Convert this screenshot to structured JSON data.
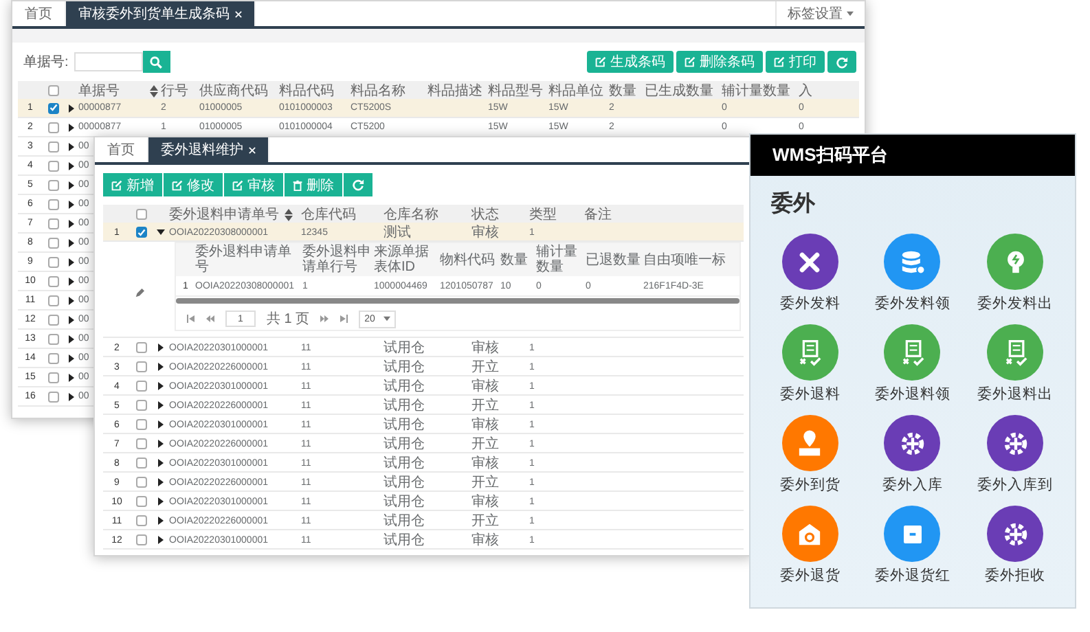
{
  "back_window": {
    "tabs": [
      {
        "label": "首页",
        "selected": false
      },
      {
        "label": "审核委外到货单生成条码",
        "selected": true
      }
    ],
    "tab_settings": "标签设置",
    "search": {
      "label": "单据号:"
    },
    "buttons": [
      {
        "label": "生成条码",
        "kind": "edit"
      },
      {
        "label": "删除条码",
        "kind": "edit"
      },
      {
        "label": "打印",
        "kind": "edit"
      },
      {
        "kind": "refresh"
      }
    ],
    "table": {
      "all_checked": false,
      "columns": [
        "单据号",
        "行号",
        "供应商代码",
        "料品代码",
        "料品名称",
        "料品描述",
        "料品型号",
        "料品单位",
        "数量",
        "已生成数量",
        "辅计量数量",
        "入"
      ],
      "rows": [
        {
          "index": "1",
          "checked": true,
          "expanded": false,
          "cells": [
            "00000877",
            "2",
            "01000005",
            "0101000003",
            "CT5200S",
            null,
            "15W",
            "15W",
            "2",
            null,
            "0",
            "0"
          ]
        },
        {
          "index": "2",
          "checked": false,
          "expanded": false,
          "cells": [
            "00000877",
            "1",
            "01000005",
            "0101000004",
            "CT5200",
            null,
            "15W",
            "15W",
            "2",
            null,
            "0",
            "0"
          ]
        },
        {
          "index": "3",
          "checked": false,
          "expanded": false,
          "cells": [
            "00"
          ]
        },
        {
          "index": "4",
          "checked": false,
          "expanded": false,
          "cells": [
            "00"
          ]
        },
        {
          "index": "5",
          "checked": false,
          "expanded": false,
          "cells": [
            "00"
          ]
        },
        {
          "index": "6",
          "checked": false,
          "expanded": false,
          "cells": [
            "00"
          ]
        },
        {
          "index": "7",
          "checked": false,
          "expanded": false,
          "cells": [
            "00"
          ]
        },
        {
          "index": "8",
          "checked": false,
          "expanded": false,
          "cells": [
            "00"
          ]
        },
        {
          "index": "9",
          "checked": false,
          "expanded": false,
          "cells": [
            "00"
          ]
        },
        {
          "index": "10",
          "checked": false,
          "expanded": false,
          "cells": [
            "00"
          ]
        },
        {
          "index": "11",
          "checked": false,
          "expanded": false,
          "cells": [
            "00"
          ]
        },
        {
          "index": "12",
          "checked": false,
          "expanded": false,
          "cells": [
            "00"
          ]
        },
        {
          "index": "13",
          "checked": false,
          "expanded": false,
          "cells": [
            "00"
          ]
        },
        {
          "index": "14",
          "checked": false,
          "expanded": false,
          "cells": [
            "00"
          ]
        },
        {
          "index": "15",
          "checked": false,
          "expanded": false,
          "cells": [
            "00"
          ]
        },
        {
          "index": "16",
          "checked": false,
          "expanded": false,
          "cells": [
            "00"
          ]
        }
      ]
    }
  },
  "front_window": {
    "tabs": [
      {
        "label": "首页",
        "selected": false
      },
      {
        "label": "委外退料维护",
        "selected": true
      }
    ],
    "toolbar": [
      {
        "label": "新增",
        "kind": "edit"
      },
      {
        "label": "修改",
        "kind": "edit"
      },
      {
        "label": "审核",
        "kind": "edit"
      },
      {
        "label": "删除",
        "kind": "trash"
      },
      {
        "kind": "refresh"
      }
    ],
    "table": {
      "all_checked": false,
      "columns": [
        "委外退料申请单号",
        "仓库代码",
        "仓库名称",
        "状态",
        "类型",
        "备注"
      ],
      "rows": [
        {
          "index": "1",
          "checked": true,
          "expanded": true,
          "cells": [
            "OOIA20220308000001",
            "12345",
            "测试",
            "审核",
            "1"
          ],
          "detail": {
            "columns": [
              "委外退料申请单号",
              "委外退料申请单行号",
              "来源单据表体ID",
              "物料代码",
              "数量",
              "辅计量数量",
              "已退数量",
              "自由项唯一标"
            ],
            "rows": [
              {
                "index": "1",
                "cells": [
                  "OOIA20220308000001",
                  "1",
                  "1000004469",
                  "1201050787",
                  "10",
                  "0",
                  "0",
                  "216F1F4D-3E"
                ]
              }
            ],
            "pager": {
              "page": "1",
              "total": "共 1 页",
              "page_size": "20"
            }
          }
        },
        {
          "index": "2",
          "checked": false,
          "expanded": false,
          "cells": [
            "OOIA20220301000001",
            "11",
            "试用仓",
            "审核",
            "1"
          ]
        },
        {
          "index": "3",
          "checked": false,
          "expanded": false,
          "cells": [
            "OOIA20220226000001",
            "11",
            "试用仓",
            "开立",
            "1"
          ]
        },
        {
          "index": "4",
          "checked": false,
          "expanded": false,
          "cells": [
            "OOIA20220301000001",
            "11",
            "试用仓",
            "审核",
            "1"
          ]
        },
        {
          "index": "5",
          "checked": false,
          "expanded": false,
          "cells": [
            "OOIA20220226000001",
            "11",
            "试用仓",
            "开立",
            "1"
          ]
        },
        {
          "index": "6",
          "checked": false,
          "expanded": false,
          "cells": [
            "OOIA20220301000001",
            "11",
            "试用仓",
            "审核",
            "1"
          ]
        },
        {
          "index": "7",
          "checked": false,
          "expanded": false,
          "cells": [
            "OOIA20220226000001",
            "11",
            "试用仓",
            "开立",
            "1"
          ]
        },
        {
          "index": "8",
          "checked": false,
          "expanded": false,
          "cells": [
            "OOIA20220301000001",
            "11",
            "试用仓",
            "审核",
            "1"
          ]
        },
        {
          "index": "9",
          "checked": false,
          "expanded": false,
          "cells": [
            "OOIA20220226000001",
            "11",
            "试用仓",
            "开立",
            "1"
          ]
        },
        {
          "index": "10",
          "checked": false,
          "expanded": false,
          "cells": [
            "OOIA20220301000001",
            "11",
            "试用仓",
            "审核",
            "1"
          ]
        },
        {
          "index": "11",
          "checked": false,
          "expanded": false,
          "cells": [
            "OOIA20220226000001",
            "11",
            "试用仓",
            "开立",
            "1"
          ]
        },
        {
          "index": "12",
          "checked": false,
          "expanded": false,
          "cells": [
            "OOIA20220301000001",
            "11",
            "试用仓",
            "审核",
            "1"
          ]
        }
      ]
    }
  },
  "mobile_panel": {
    "title": "WMS扫码平台",
    "section": "委外",
    "tiles": [
      {
        "label": "委外发料",
        "kind": "tools",
        "color": "#6a3db5"
      },
      {
        "label": "委外发料领",
        "kind": "database",
        "color": "#2196f3"
      },
      {
        "label": "委外发料出",
        "kind": "bulb",
        "color": "#4caf50"
      },
      {
        "label": "委外退料",
        "kind": "document",
        "color": "#4caf50"
      },
      {
        "label": "委外退料领",
        "kind": "document",
        "color": "#4caf50"
      },
      {
        "label": "委外退料出",
        "kind": "document",
        "color": "#4caf50"
      },
      {
        "label": "委外到货",
        "kind": "pin",
        "color": "#ff7800"
      },
      {
        "label": "委外入库",
        "kind": "gear",
        "color": "#6a3db5"
      },
      {
        "label": "委外入库到",
        "kind": "gear",
        "color": "#6a3db5"
      },
      {
        "label": "委外退货",
        "kind": "warehouse",
        "color": "#ff7800"
      },
      {
        "label": "委外退货红",
        "kind": "box",
        "color": "#2196f3"
      },
      {
        "label": "委外拒收",
        "kind": "gear",
        "color": "#6a3db5"
      }
    ]
  }
}
